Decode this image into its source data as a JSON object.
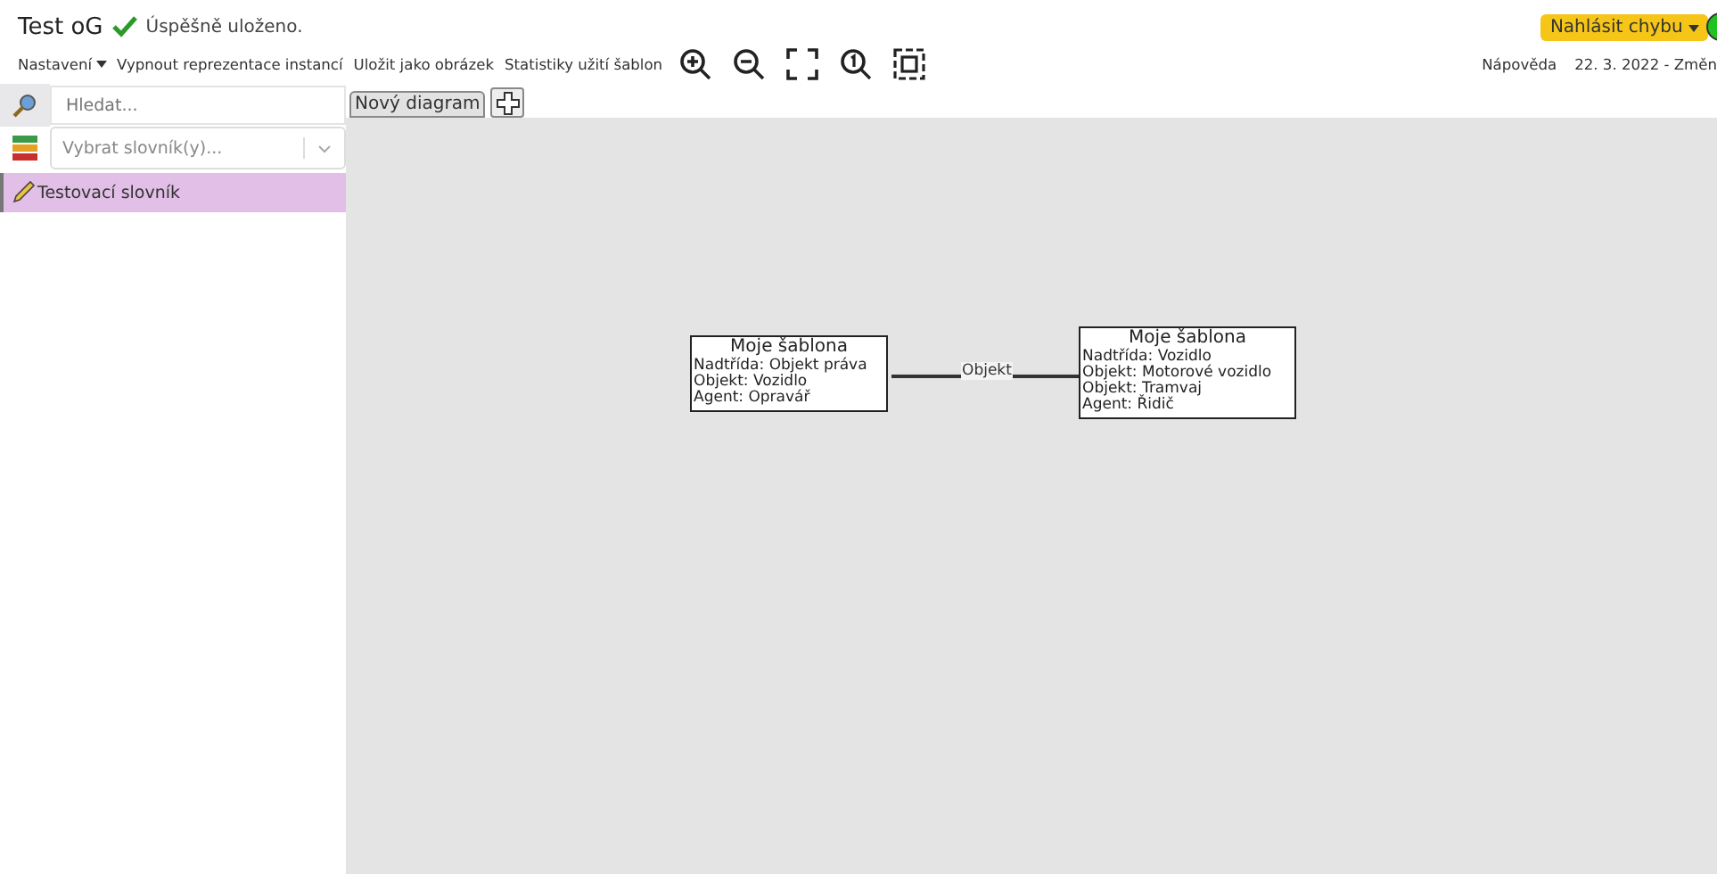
{
  "title": "Test oG",
  "save_status": "Úspěšně uloženo.",
  "report_button": "Nahlásit chybu",
  "status_online": true,
  "toolbar": {
    "settings": "Nastavení",
    "items": [
      "Vypnout reprezentace instancí",
      "Uložit jako obrázek",
      "Statistiky užití šablon"
    ],
    "help": "Nápověda",
    "version": "22. 3. 2022 - Změn"
  },
  "search": {
    "placeholder": "Hledat..."
  },
  "vocabulary_select": {
    "placeholder": "Vybrat slovník(y)..."
  },
  "vocabularies": [
    {
      "label": "Testovací slovník",
      "selected": true
    }
  ],
  "tabs": [
    {
      "label": "Nový diagram",
      "selected": true
    }
  ],
  "nodes": [
    {
      "title": "Moje šablona",
      "lines": [
        "Nadtřída: Objekt práva",
        "Objekt: Vozidlo",
        "Agent: Opravář"
      ]
    },
    {
      "title": "Moje šablona",
      "lines": [
        "Nadtřída: Vozidlo",
        "Objekt: Motorové vozidlo",
        "Objekt: Tramvaj",
        "Agent: Řidič"
      ]
    }
  ],
  "edges": [
    {
      "label": "Objekt"
    }
  ]
}
